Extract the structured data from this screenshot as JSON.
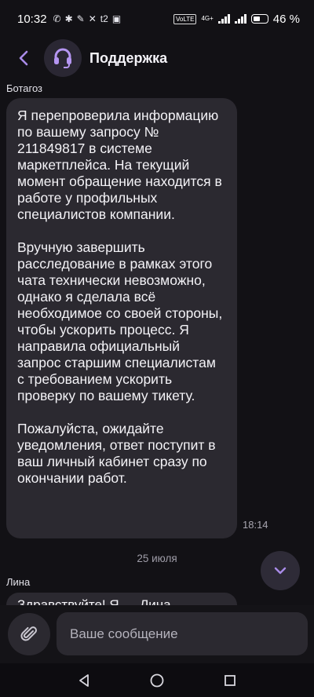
{
  "status_bar": {
    "time": "10:32",
    "network_label": "4G+",
    "battery_percent": "46 %",
    "volte_label": "VoLTE"
  },
  "header": {
    "title": "Поддержка"
  },
  "messages": [
    {
      "sender": "Ботагоз",
      "text": "Я перепроверила информацию по вашему запросу № 211849817 в системе маркетплейса. На текущий момент обращение находится в работе у профильных специалистов компании.\n\nВручную завершить расследование в рамках этого чата технически невозможно, однако я сделала всё необходимое со своей стороны, чтобы ускорить процесс. Я направила официальный запрос старшим специалистам с требованием ускорить проверку по вашему тикету.\n\nПожалуйста, ожидайте уведомления, ответ поступит в ваш личный кабинет сразу по окончании работ.",
      "time": "18:14"
    }
  ],
  "date_separator": "25 июля",
  "second_message": {
    "sender": "Лина",
    "text_partial": "Здравствуйте! Я — Лина"
  },
  "composer": {
    "placeholder": "Ваше сообщение"
  },
  "colors": {
    "accent": "#a98be8",
    "bubble": "#2b2930",
    "background": "#121115"
  }
}
